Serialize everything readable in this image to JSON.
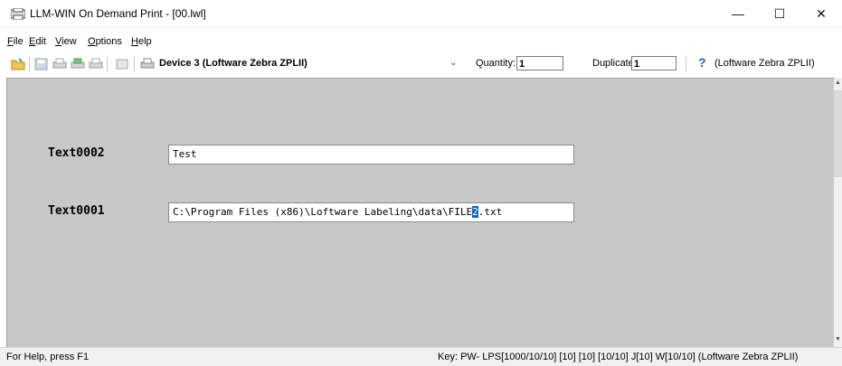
{
  "window": {
    "title": "LLM-WIN On Demand Print - [00.lwl]",
    "minimize": "—",
    "maximize": "☐",
    "close": "✕"
  },
  "menu": [
    {
      "label": "File",
      "key": "F",
      "rest": "ile"
    },
    {
      "label": "Edit",
      "key": "E",
      "rest": "dit"
    },
    {
      "label": "View",
      "key": "V",
      "rest": "iew"
    },
    {
      "label": "Options",
      "key": "O",
      "rest": "ptions"
    },
    {
      "label": "Help",
      "key": "H",
      "rest": "elp"
    }
  ],
  "toolbar": {
    "device": "Device 3  (Loftware Zebra ZPLII)",
    "quantity_label": "Quantity:",
    "quantity_value": "1",
    "duplicates_label": "Duplicates:",
    "duplicates_value": "1",
    "help_symbol": "?",
    "printer_text": "(Loftware Zebra ZPLII)"
  },
  "fields": [
    {
      "label": "Text0002",
      "value": "Test"
    },
    {
      "label": "Text0001",
      "value_before": "C:\\Program Files (x86)\\Loftware Labeling\\data\\FILE",
      "value_selected": "2",
      "value_after": ".txt"
    }
  ],
  "status": {
    "left": "For Help, press F1",
    "right": "Key: PW- LPS[1000/10/10] [10] [10] [10/10] J[10] W[10/10]  (Loftware Zebra ZPLII)"
  },
  "colors": {
    "client_bg": "#c8c8c8",
    "selection": "#0a64d8",
    "help": "#1e5fd8"
  }
}
